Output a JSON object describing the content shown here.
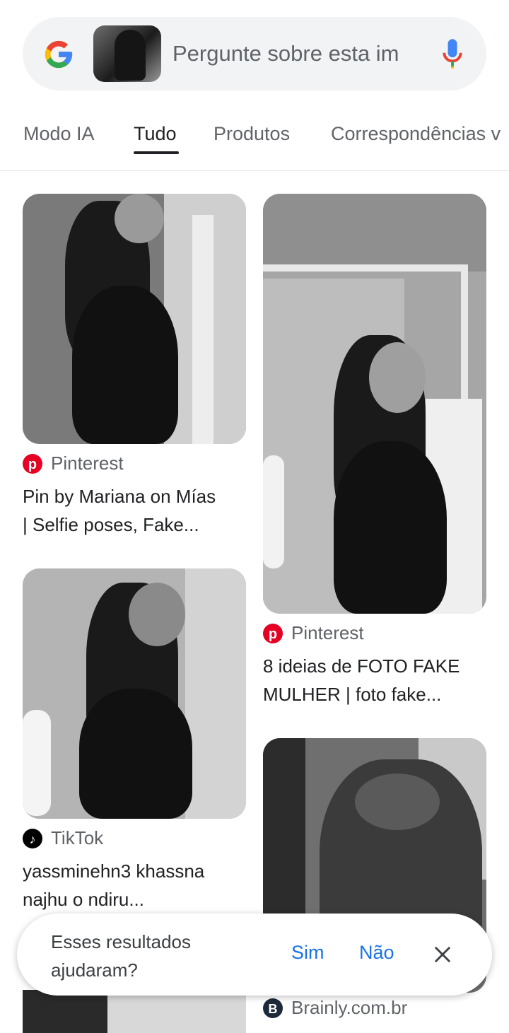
{
  "search": {
    "placeholder": "Pergunte sobre esta im",
    "google_colors": [
      "#4285F4",
      "#EA4335",
      "#FBBC05",
      "#34A853"
    ]
  },
  "tabs": [
    {
      "label": "Modo IA"
    },
    {
      "label": "Tudo",
      "active": true
    },
    {
      "label": "Produtos"
    },
    {
      "label": "Correspondências v"
    }
  ],
  "results": [
    {
      "source": "Pinterest",
      "source_icon": "pinterest-icon",
      "title_line1": "Pin by Mariana on Mías",
      "title_line2": "| Selfie poses, Fake..."
    },
    {
      "source": "Pinterest",
      "source_icon": "pinterest-icon",
      "title_line1": "8 ideias de FOTO FAKE",
      "title_line2": "MULHER | foto fake..."
    },
    {
      "source": "TikTok",
      "source_icon": "tiktok-icon",
      "title_line1": "yassminehn3 khassna",
      "title_line2": "najhu o ndiru..."
    },
    {
      "source": "Brainly.com.br",
      "source_icon": "brainly-icon"
    }
  ],
  "feedback": {
    "question_line1": "Esses resultados",
    "question_line2": "ajudaram?",
    "yes": "Sim",
    "no": "Não"
  },
  "colors": {
    "accent_blue": "#1a73e8",
    "pinterest_red": "#E60023"
  }
}
